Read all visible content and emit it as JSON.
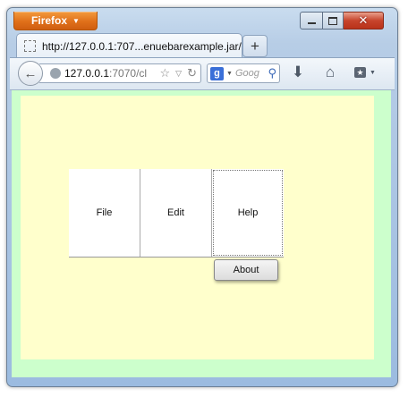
{
  "browser": {
    "app_button": "Firefox",
    "tab_title": "http://127.0.0.1:707...enuebarexample.jar/",
    "url_host": "127.0.0.1",
    "url_rest": ":7070/cl",
    "search_placeholder": "Goog"
  },
  "menubar": {
    "items": [
      {
        "label": "File"
      },
      {
        "label": "Edit"
      },
      {
        "label": "Help"
      }
    ],
    "help_submenu": {
      "label": "About"
    }
  },
  "colors": {
    "outer_background": "#ccffcc",
    "panel_background": "#ffffcc",
    "menubar_background": "#ffffff"
  },
  "icons": [
    "firefox-dropdown-icon",
    "minimize-icon",
    "maximize-icon",
    "close-icon",
    "page-favicon-icon",
    "new-tab-icon",
    "back-icon",
    "globe-icon",
    "bookmark-star-icon",
    "dropmarker-icon",
    "reload-icon",
    "google-search-icon",
    "magnifier-icon",
    "download-icon",
    "home-icon",
    "bookmarks-menu-icon"
  ]
}
